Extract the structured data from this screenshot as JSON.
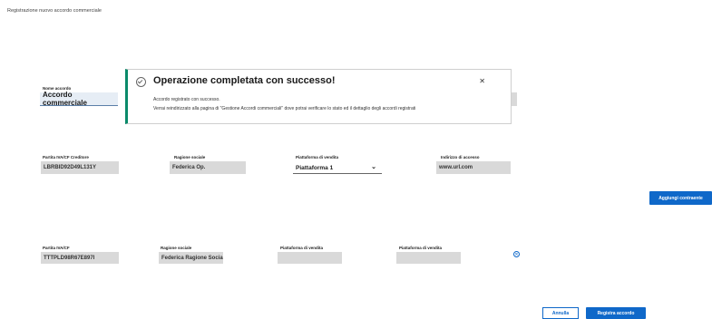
{
  "page": {
    "title": "Registrazione nuovo accordo commerciale"
  },
  "accordo": {
    "label": "Nome accordo",
    "value": "Accordo commerciale"
  },
  "toast": {
    "title": "Operazione completata con successo!",
    "line1": "Accordo registrato con successo.",
    "line2": "Verrai reindirizzato alla pagina di \"Gestione Accordi commerciali\" dove potrai verificare lo stato ed il dettaglio degli accordi registrati",
    "close_icon": "close-icon",
    "status_icon": "check-circle-icon",
    "accent_color": "#0a8a6a"
  },
  "creditore": {
    "piva_label": "Partita IVA/CF Creditore",
    "piva_value": "LBRBID92D49L131Y",
    "ragione_label": "Ragione sociale",
    "ragione_value": "Federica Op.",
    "piattaforma_label": "Piattaforma di vendita",
    "piattaforma_value": "Piattaforma 1",
    "indirizzo_label": "Indirizzo di accesso",
    "indirizzo_value": "www.url.com"
  },
  "contraente": {
    "piva_label": "Partita IVA/CF",
    "piva_value": "TTTPLD98R67E897I",
    "ragione_label": "Ragione sociale",
    "ragione_value": "Federica Ragione Sociale",
    "piattaforma1_label": "Piattaforma di vendita",
    "piattaforma1_value": "",
    "piattaforma2_label": "Piattaforma di vendita",
    "piattaforma2_value": ""
  },
  "buttons": {
    "aggiungi": "Aggiungi contraente",
    "annulla": "Annulla",
    "registra": "Registra accordo",
    "primary_color": "#0f68c9"
  }
}
